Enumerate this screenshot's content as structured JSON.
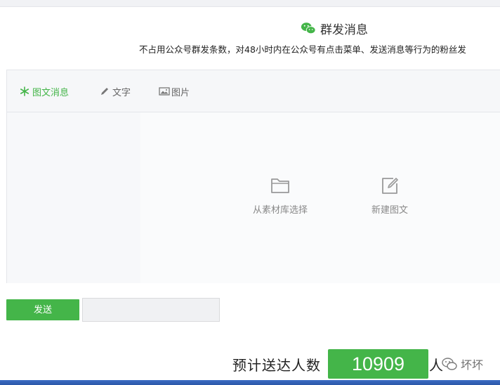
{
  "header": {
    "title": "群发消息",
    "description": "不占用公众号群发条数，对48小时内在公众号有点击菜单、发送消息等行为的粉丝发"
  },
  "tabs": [
    {
      "label": "图文消息",
      "icon": "snowflake-icon",
      "active": true
    },
    {
      "label": "文字",
      "icon": "pencil-icon",
      "active": false
    },
    {
      "label": "图片",
      "icon": "image-icon",
      "active": false
    }
  ],
  "actions": {
    "library_label": "从素材库选择",
    "new_label": "新建图文"
  },
  "send": {
    "button_label": "发送"
  },
  "estimate": {
    "label": "预计送达人数",
    "count": "10909",
    "unit": "人"
  },
  "watermark": {
    "text": "坏坏"
  },
  "colors": {
    "accent": "#44b549",
    "border": "#e4e6ea",
    "muted_text": "#888888"
  }
}
